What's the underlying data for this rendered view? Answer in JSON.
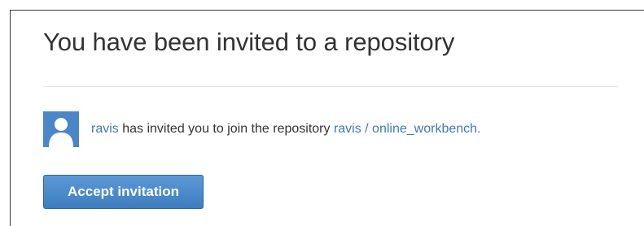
{
  "heading": "You have been invited to a repository",
  "invite": {
    "inviter": "ravis",
    "message": " has invited you to join the repository ",
    "repository": "ravis / online_workbench",
    "trailing": "."
  },
  "accept_button": "Accept invitation",
  "icons": {
    "avatar": "user-avatar-icon"
  },
  "colors": {
    "link": "#4078c0",
    "button": "#4a8ad0",
    "avatar_bg": "#4a86c8"
  }
}
